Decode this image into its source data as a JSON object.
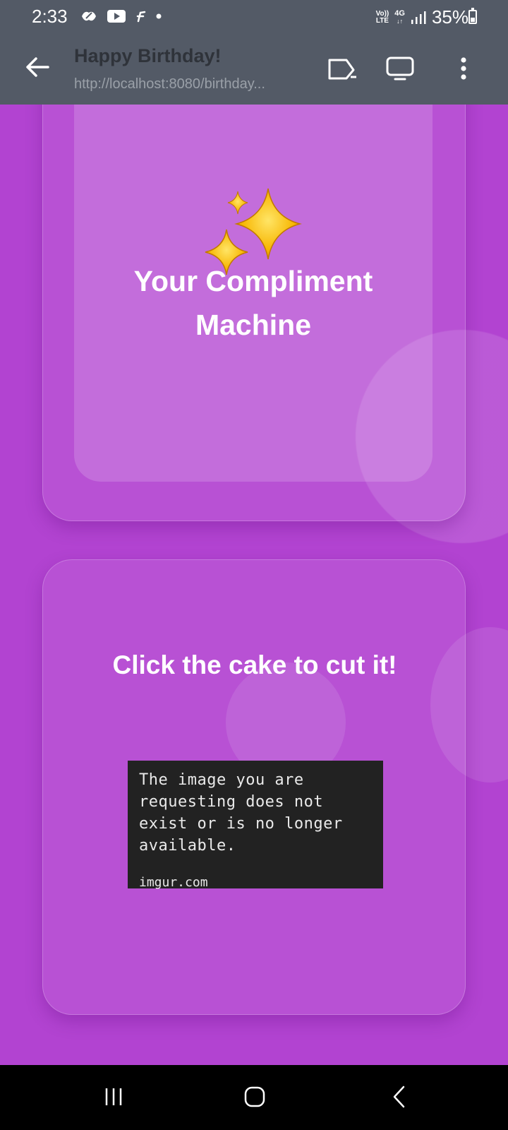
{
  "status_bar": {
    "time": "2:33",
    "network_label_top": "Vo))",
    "network_label_bottom": "LTE",
    "network_type": "4G",
    "battery": "35%",
    "icons": [
      "app-icon",
      "youtube-icon",
      "fantasy-app-icon",
      "dot-icon",
      "signal-icon",
      "battery-icon"
    ]
  },
  "browser": {
    "title": "Happy Birthday!",
    "url": "http://localhost:8080/birthday...",
    "icons": [
      "back-arrow-icon",
      "cast-icon",
      "display-icon",
      "more-vert-icon"
    ]
  },
  "cards": {
    "compliment": {
      "icon": "sparkles-icon",
      "title": "Your Compliment Machine"
    },
    "cake": {
      "title": "Click the cake to cut it!",
      "image_message": "The image you are requesting does not exist or is no longer available.",
      "image_source": "imgur.com"
    }
  },
  "nav_bar": {
    "icons": [
      "recents-icon",
      "home-icon",
      "back-icon"
    ]
  },
  "colors": {
    "background": "#b243d1",
    "toolbar": "#535a66",
    "sparkle": "#f7c21c"
  }
}
